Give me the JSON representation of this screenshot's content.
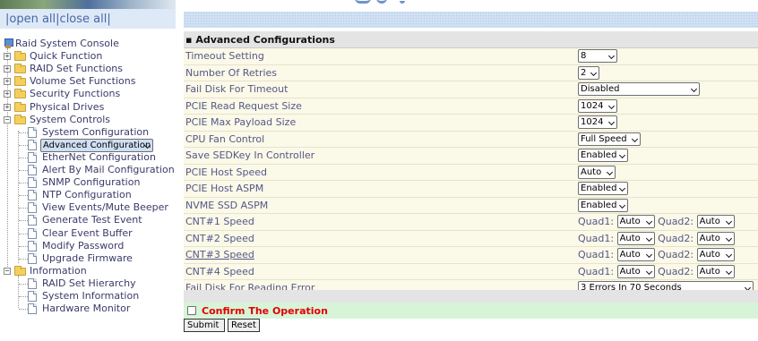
{
  "nav": {
    "open_all": "open all",
    "close_all": "close all",
    "separator": "|",
    "root": "Raid System Console",
    "groups": [
      {
        "label": "Quick Function",
        "expanded": false
      },
      {
        "label": "RAID Set Functions",
        "expanded": false
      },
      {
        "label": "Volume Set Functions",
        "expanded": false
      },
      {
        "label": "Security Functions",
        "expanded": false
      },
      {
        "label": "Physical Drives",
        "expanded": false
      },
      {
        "label": "System Controls",
        "expanded": true,
        "items": [
          "System Configuration",
          "Advanced Configuration",
          "EtherNet Configuration",
          "Alert By Mail Configuration",
          "SNMP Configuration",
          "NTP Configuration",
          "View Events/Mute Beeper",
          "Generate Test Event",
          "Clear Event Buffer",
          "Modify Password",
          "Upgrade Firmware"
        ]
      },
      {
        "label": "Information",
        "expanded": true,
        "items": [
          "RAID Set Hierarchy",
          "System Information",
          "Hardware Monitor"
        ]
      }
    ],
    "selected": "Advanced Configuration"
  },
  "main": {
    "title_bullet": "▪",
    "title": "Advanced Configurations",
    "rows": [
      {
        "label": "Timeout Setting",
        "value": "8"
      },
      {
        "label": "Number Of Retries",
        "value": "2"
      },
      {
        "label": "Fail Disk For Timeout",
        "value": "Disabled"
      },
      {
        "label": "PCIE Read Request Size",
        "value": "1024"
      },
      {
        "label": "PCIE Max Payload Size",
        "value": "1024"
      },
      {
        "label": "CPU Fan Control",
        "value": "Full Speed"
      },
      {
        "label": "Save SEDKey In Controller",
        "value": "Enabled"
      },
      {
        "label": "PCIE Host Speed",
        "value": "Auto"
      },
      {
        "label": "PCIE Host ASPM",
        "value": "Enabled"
      },
      {
        "label": "NVME SSD ASPM",
        "value": "Enabled"
      },
      {
        "label": "CNT#1 Speed",
        "quad1_label": "Quad1:",
        "quad1": "Auto",
        "quad2_label": "Quad2:",
        "quad2": "Auto"
      },
      {
        "label": "CNT#2 Speed",
        "quad1_label": "Quad1:",
        "quad1": "Auto",
        "quad2_label": "Quad2:",
        "quad2": "Auto"
      },
      {
        "label": "CNT#3 Speed",
        "quad1_label": "Quad1:",
        "quad1": "Auto",
        "quad2_label": "Quad2:",
        "quad2": "Auto"
      },
      {
        "label": "CNT#4 Speed",
        "quad1_label": "Quad1:",
        "quad1": "Auto",
        "quad2_label": "Quad2:",
        "quad2": "Auto"
      },
      {
        "label": "Fail Disk For Reading Error",
        "value": "3 Errors In 70 Seconds"
      }
    ],
    "confirm_label": "Confirm The Operation",
    "confirm_checked": false,
    "submit_label": "Submit",
    "reset_label": "Reset"
  },
  "colors": {
    "row_bg": "#fbf9e7",
    "label_text": "#55578a",
    "confirm_bg": "#d8f4d8",
    "confirm_text": "#e00000",
    "header_dots": "#cfe0f3"
  }
}
